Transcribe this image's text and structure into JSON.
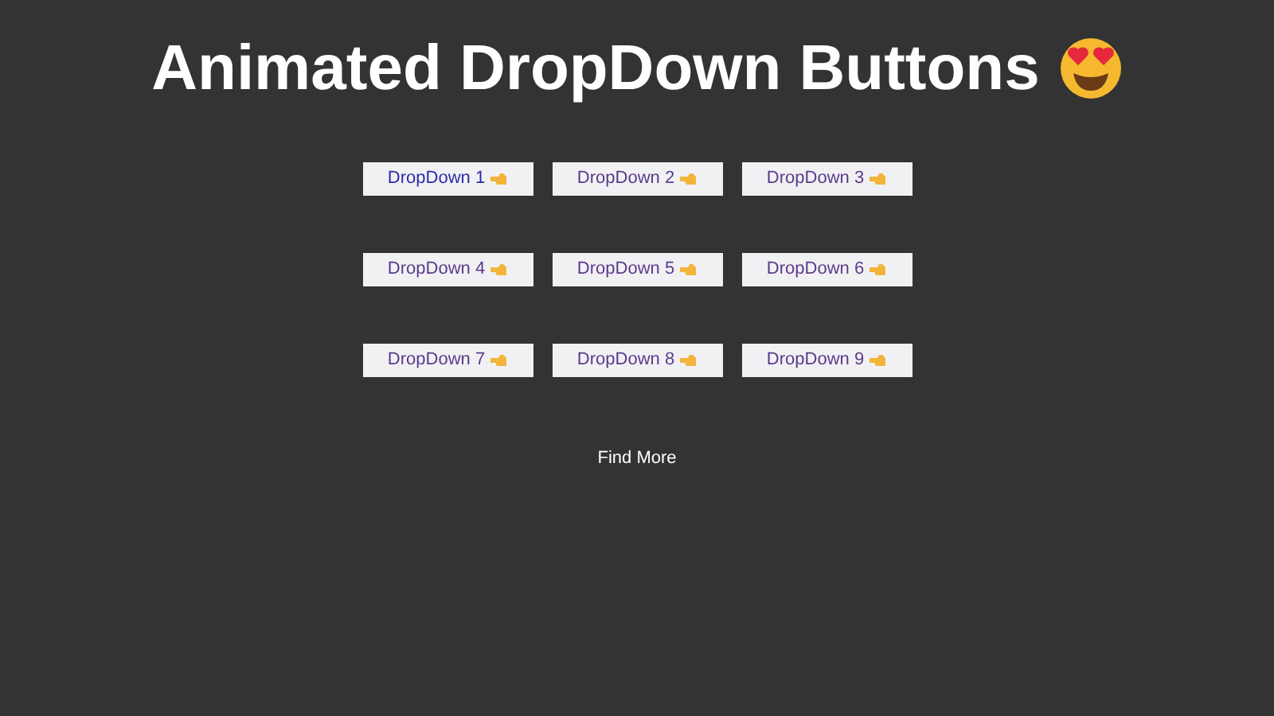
{
  "title": "Animated DropDown Buttons",
  "buttons": [
    {
      "label": "DropDown 1",
      "selected": true
    },
    {
      "label": "DropDown 2",
      "selected": false
    },
    {
      "label": "DropDown 3",
      "selected": false
    },
    {
      "label": "DropDown 4",
      "selected": false
    },
    {
      "label": "DropDown 5",
      "selected": false
    },
    {
      "label": "DropDown 6",
      "selected": false
    },
    {
      "label": "DropDown 7",
      "selected": false
    },
    {
      "label": "DropDown 8",
      "selected": false
    },
    {
      "label": "DropDown 9",
      "selected": false
    }
  ],
  "link": "Find More"
}
